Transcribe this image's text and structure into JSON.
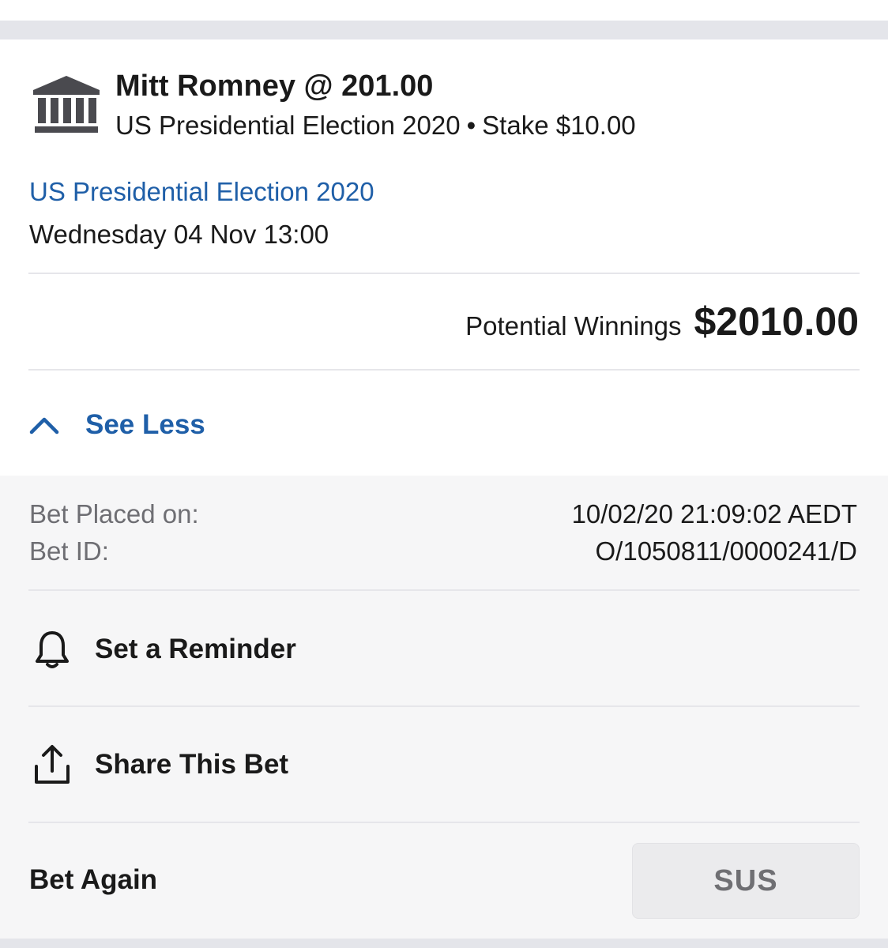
{
  "bet": {
    "selection_title": "Mitt Romney @ 201.00",
    "market_name": "US Presidential Election 2020",
    "separator": "•",
    "stake_text": "Stake $10.00",
    "market_icon": "government-building-icon"
  },
  "event": {
    "link_text": "US Presidential Election 2020",
    "datetime": "Wednesday 04 Nov 13:00"
  },
  "winnings": {
    "label": "Potential Winnings",
    "amount": "$2010.00"
  },
  "toggle": {
    "label": "See Less",
    "icon": "chevron-up-icon"
  },
  "details": {
    "placed_label": "Bet Placed on:",
    "placed_value": "10/02/20 21:09:02 AEDT",
    "id_label": "Bet ID:",
    "id_value": "O/1050811/0000241/D"
  },
  "actions": {
    "reminder_label": "Set a Reminder",
    "reminder_icon": "bell-icon",
    "share_label": "Share This Bet",
    "share_icon": "share-icon"
  },
  "bet_again": {
    "label": "Bet Again",
    "button_label": "SUS"
  },
  "colors": {
    "link_blue": "#1f5fa8",
    "panel_bg": "#f6f6f7",
    "divider": "#e6e6ea"
  }
}
